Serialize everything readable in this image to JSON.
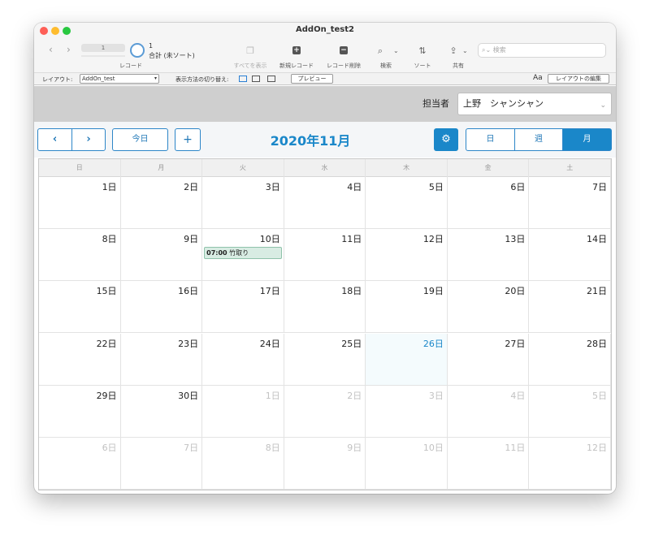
{
  "window": {
    "title": "AddOn_test2",
    "colors": {
      "close": "#fe5f57",
      "minimize": "#febc2e",
      "zoom": "#28c840"
    }
  },
  "toolbar": {
    "record_current": "1",
    "record_count": "1",
    "record_sort_status": "合計 (未ソート)",
    "records_label": "レコード",
    "show_all_label": "すべてを表示",
    "new_record_label": "新規レコード",
    "delete_record_label": "レコード削除",
    "find_label": "検索",
    "sort_label": "ソート",
    "share_label": "共有",
    "search_placeholder": "検索"
  },
  "layoutbar": {
    "layout_label": "レイアウト:",
    "layout_value": "AddOn_test",
    "view_mode_label": "表示方法の切り替え:",
    "preview_label": "プレビュー",
    "edit_layout_label": "レイアウトの編集",
    "font_icon_text": "Aa"
  },
  "assignee": {
    "label": "担当者",
    "value": "上野　シャンシャン"
  },
  "calendar": {
    "prev_label": "‹",
    "next_label": "›",
    "today_label": "今日",
    "add_label": "+",
    "gear_label": "⚙",
    "month_title": "2020年11月",
    "view_day_label": "日",
    "view_week_label": "週",
    "view_month_label": "月",
    "active_view": "month",
    "accent_color": "#1a87c9",
    "weekdays": [
      "日",
      "月",
      "火",
      "水",
      "木",
      "金",
      "土"
    ],
    "weeks": [
      [
        {
          "d": "1日",
          "o": false
        },
        {
          "d": "2日",
          "o": false
        },
        {
          "d": "3日",
          "o": false
        },
        {
          "d": "4日",
          "o": false
        },
        {
          "d": "5日",
          "o": false
        },
        {
          "d": "6日",
          "o": false
        },
        {
          "d": "7日",
          "o": false
        }
      ],
      [
        {
          "d": "8日",
          "o": false
        },
        {
          "d": "9日",
          "o": false
        },
        {
          "d": "10日",
          "o": false
        },
        {
          "d": "11日",
          "o": false
        },
        {
          "d": "12日",
          "o": false
        },
        {
          "d": "13日",
          "o": false
        },
        {
          "d": "14日",
          "o": false
        }
      ],
      [
        {
          "d": "15日",
          "o": false
        },
        {
          "d": "16日",
          "o": false
        },
        {
          "d": "17日",
          "o": false
        },
        {
          "d": "18日",
          "o": false
        },
        {
          "d": "19日",
          "o": false
        },
        {
          "d": "20日",
          "o": false
        },
        {
          "d": "21日",
          "o": false
        }
      ],
      [
        {
          "d": "22日",
          "o": false
        },
        {
          "d": "23日",
          "o": false
        },
        {
          "d": "24日",
          "o": false
        },
        {
          "d": "25日",
          "o": false
        },
        {
          "d": "26日",
          "o": false,
          "today": true
        },
        {
          "d": "27日",
          "o": false
        },
        {
          "d": "28日",
          "o": false
        }
      ],
      [
        {
          "d": "29日",
          "o": false
        },
        {
          "d": "30日",
          "o": false
        },
        {
          "d": "1日",
          "o": true
        },
        {
          "d": "2日",
          "o": true
        },
        {
          "d": "3日",
          "o": true
        },
        {
          "d": "4日",
          "o": true
        },
        {
          "d": "5日",
          "o": true
        }
      ],
      [
        {
          "d": "6日",
          "o": true
        },
        {
          "d": "7日",
          "o": true
        },
        {
          "d": "8日",
          "o": true
        },
        {
          "d": "9日",
          "o": true
        },
        {
          "d": "10日",
          "o": true
        },
        {
          "d": "11日",
          "o": true
        },
        {
          "d": "12日",
          "o": true
        }
      ]
    ],
    "events": [
      {
        "week": 1,
        "day": 2,
        "time": "07:00",
        "title": "竹取り"
      }
    ]
  }
}
